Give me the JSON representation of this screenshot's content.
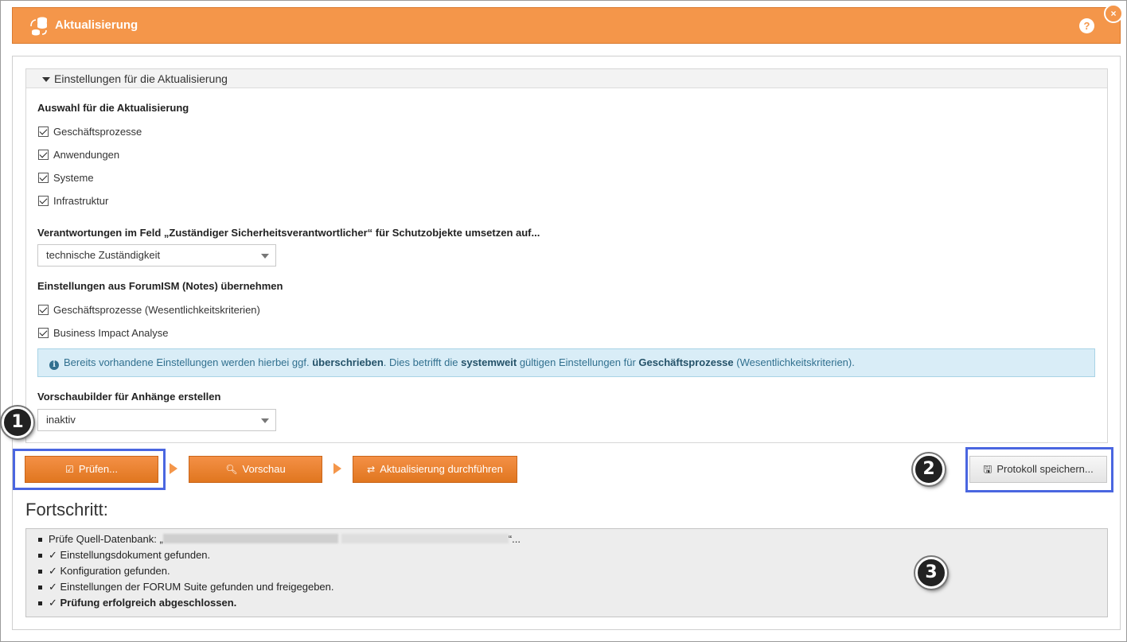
{
  "window": {
    "title": "Aktualisierung",
    "help_label": "?",
    "close_label": "×"
  },
  "section": {
    "header": "Einstellungen für die Aktualisierung",
    "selection_label": "Auswahl für die Aktualisierung",
    "selection_items": [
      {
        "label": "Geschäftsprozesse",
        "checked": true
      },
      {
        "label": "Anwendungen",
        "checked": true
      },
      {
        "label": "Systeme",
        "checked": true
      },
      {
        "label": "Infrastruktur",
        "checked": true
      }
    ],
    "responsibility_label": "Verantwortungen im Feld „Zuständiger Sicherheitsverantwortlicher“ für Schutzobjekte umsetzen auf...",
    "responsibility_value": "technische Zuständigkeit",
    "forumism_label": "Einstellungen aus ForumISM (Notes) übernehmen",
    "forumism_items": [
      {
        "label": "Geschäftsprozesse (Wesentlichkeitskriterien)",
        "checked": true
      },
      {
        "label": "Business Impact Analyse",
        "checked": true
      }
    ],
    "info": {
      "part1": "Bereits vorhandene Einstellungen werden hierbei ggf. ",
      "bold1": "überschrieben",
      "part2": ". Dies betrifft die ",
      "bold2": "systemweit",
      "part3": " gültigen Einstellungen für ",
      "bold3": "Geschäftsprozesse",
      "part4": " (Wesentlichkeitskriterien)."
    },
    "preview_label": "Vorschaubilder für Anhänge erstellen",
    "preview_value": "inaktiv"
  },
  "actions": {
    "check": "Prüfen...",
    "preview": "Vorschau",
    "run": "Aktualisierung durchführen",
    "save_log": "Protokoll speichern..."
  },
  "badges": [
    "1",
    "2",
    "3"
  ],
  "progress": {
    "title": "Fortschritt:",
    "source_prefix": "Prüfe Quell-Datenbank: „",
    "source_suffix": "“...",
    "items": [
      "✓ Einstellungsdokument gefunden.",
      "✓ Konfiguration gefunden.",
      "✓ Einstellungen der FORUM Suite gefunden und freigegeben."
    ],
    "final": "✓ Prüfung erfolgreich abgeschlossen."
  },
  "colors": {
    "accent": "#f4964a",
    "highlight": "#4a66e0",
    "info_bg": "#d9edf7"
  }
}
